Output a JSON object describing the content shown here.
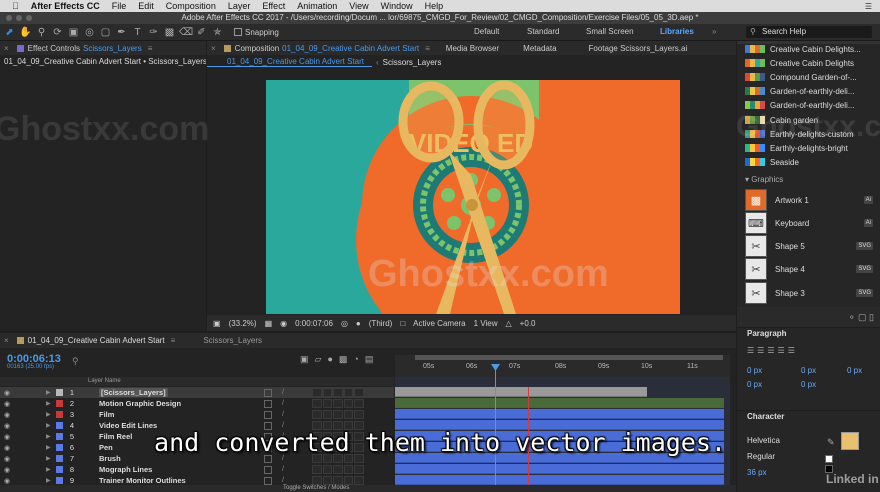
{
  "menubar": {
    "items": [
      "After Effects CC",
      "File",
      "Edit",
      "Composition",
      "Layer",
      "Effect",
      "Animation",
      "View",
      "Window",
      "Help"
    ]
  },
  "titlebar": {
    "title": "Adobe After Effects CC 2017 - /Users/recording/Docum ... lor/69875_CMGD_For_Review/02_CMGD_Composition/Exercise Files/05_05_3D.aep *"
  },
  "toolbar": {
    "snapping_label": "Snapping",
    "workspaces": [
      "Default",
      "Standard",
      "Small Screen",
      "Libraries"
    ],
    "active_workspace": "Libraries",
    "search_placeholder": "Search Help"
  },
  "effect_controls": {
    "tab_label": "Effect Controls",
    "tab_layer": "Scissors_Layers",
    "breadcrumb": "01_04_09_Creative Cabin Advert Start • Scissors_Layers"
  },
  "composition": {
    "tab_label": "Composition",
    "tab_name": "01_04_09_Creative Cabin Advert Start",
    "other_tabs": [
      "Media Browser",
      "Metadata",
      "Footage Scissors_Layers.ai"
    ],
    "subtabs": [
      "01_04_09_Creative Cabin Advert Start",
      "Scissors_Layers"
    ],
    "artwork_text": "VIDEO ED",
    "footer": {
      "zoom": "(33.2%)",
      "timecode": "0:00:07:06",
      "resolution": "(Third)",
      "camera": "Active Camera",
      "view": "1 View",
      "exposure": "+0.0"
    }
  },
  "libraries": {
    "items": [
      {
        "label": "Creative Cabin Delights...",
        "colors": [
          "#3a7bd5",
          "#e8b84a",
          "#e06a2a",
          "#6dbf5c"
        ]
      },
      {
        "label": "Creative Cabin Delights",
        "colors": [
          "#e06a2a",
          "#e8b84a",
          "#3aa39a",
          "#6dbf5c"
        ]
      },
      {
        "label": "Compound Garden-of-...",
        "colors": [
          "#d84a3a",
          "#e8b84a",
          "#5a9a4a",
          "#3a5a8a"
        ]
      },
      {
        "label": "Garden-of-earthly-deli...",
        "colors": [
          "#2a7a4a",
          "#e8c84a",
          "#d86a2a",
          "#4a8ac8"
        ]
      },
      {
        "label": "Garden-of-earthly-deli...",
        "colors": [
          "#8ac84a",
          "#2a8a6a",
          "#e8a83a",
          "#d84a4a"
        ]
      },
      {
        "label": "Cabin garden",
        "colors": [
          "#c8a84a",
          "#6a9a3a",
          "#3a6a4a",
          "#e8d8a8"
        ]
      },
      {
        "label": "Earthly-delights-custom",
        "colors": [
          "#3a9a8a",
          "#e8b84a",
          "#d85a3a",
          "#4a6ac8"
        ]
      },
      {
        "label": "Earthly-delights-bright",
        "colors": [
          "#2ab88a",
          "#f8c83a",
          "#f85a2a",
          "#3a8af8"
        ]
      },
      {
        "label": "Seaside",
        "colors": [
          "#1a6ad8",
          "#f8d83a",
          "#f86a1a",
          "#3ac8e8"
        ]
      }
    ],
    "graphics_header": "Graphics",
    "graphics": [
      {
        "label": "Artwork 1",
        "badge": "Ai",
        "icon": "artwork-icon"
      },
      {
        "label": "Keyboard",
        "badge": "Ai",
        "icon": "keyboard-icon"
      },
      {
        "label": "Shape 5",
        "badge": "SVG",
        "icon": "scissors-icon"
      },
      {
        "label": "Shape 4",
        "badge": "SVG",
        "icon": "scissors-icon"
      },
      {
        "label": "Shape 3",
        "badge": "SVG",
        "icon": "scissors-icon"
      }
    ]
  },
  "paragraph": {
    "title": "Paragraph",
    "fields": [
      "0 px",
      "0 px",
      "0 px",
      "0 px",
      "0 px"
    ]
  },
  "character": {
    "title": "Character",
    "font": "Helvetica",
    "style": "Regular",
    "size": "36 px"
  },
  "timeline": {
    "tab_label": "01_04_09_Creative Cabin Advert Start",
    "tab2_label": "Scissors_Layers",
    "timecode": "0:00:06:13",
    "frame_info": "00163 (25.00 fps)",
    "layer_name_header": "Layer Name",
    "ticks": [
      "05s",
      "06s",
      "07s",
      "08s",
      "09s",
      "10s",
      "11s"
    ],
    "toggle_label": "Toggle Switches / Modes",
    "layers": [
      {
        "num": "1",
        "name": "[Scissors_Layers]",
        "color": "#b8b8b8",
        "selected": true
      },
      {
        "num": "2",
        "name": "Motion Graphic Design",
        "color": "#c83a3a"
      },
      {
        "num": "3",
        "name": "Film",
        "color": "#c83a3a"
      },
      {
        "num": "4",
        "name": "Video Edit Lines",
        "color": "#5a7ae8"
      },
      {
        "num": "5",
        "name": "Film Reel",
        "color": "#5a7ae8"
      },
      {
        "num": "6",
        "name": "Pen",
        "color": "#5a7ae8"
      },
      {
        "num": "7",
        "name": "Brush",
        "color": "#5a7ae8"
      },
      {
        "num": "8",
        "name": "Mograph Lines",
        "color": "#5a7ae8"
      },
      {
        "num": "9",
        "name": "Trainer Monitor Outlines",
        "color": "#5a7ae8"
      }
    ]
  },
  "overlay": {
    "subtitle": "and converted them into vector images.",
    "watermark": "Ghostxx.com",
    "brand": "Linked in"
  }
}
